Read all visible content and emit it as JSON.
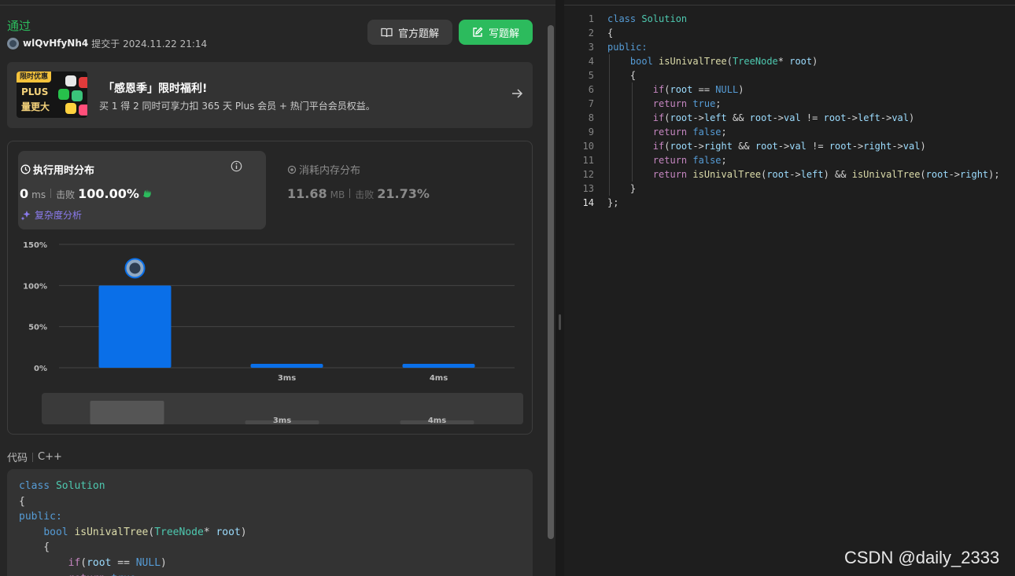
{
  "submission": {
    "status": "通过",
    "username": "wlQvHfyNh4",
    "submitted_text": "提交于 2024.11.22 21:14"
  },
  "buttons": {
    "official_solution": "官方题解",
    "write_solution": "写题解"
  },
  "promo": {
    "tag": "限时优惠",
    "image_line1": "PLUS",
    "image_line2": "量更大",
    "title": "「感恩季」限时福利!",
    "description": "买 1 得 2 同时可享力扣 365 天 Plus 会员 + 热门平台会员权益。"
  },
  "runtime": {
    "title": "执行用时分布",
    "value": "0",
    "unit": "ms",
    "beat_label": "击败",
    "beat_value": "100.00%",
    "complexity_link": "复杂度分析"
  },
  "memory": {
    "title": "消耗内存分布",
    "value": "11.68",
    "unit": "MB",
    "beat_label": "击败",
    "beat_value": "21.73%"
  },
  "chart_data": {
    "type": "bar",
    "categories": [
      "",
      "3ms",
      "4ms"
    ],
    "values": [
      100,
      3,
      3
    ],
    "yticks": [
      "150%",
      "100%",
      "50%",
      "0%"
    ],
    "ylim": [
      0,
      150
    ],
    "bar_color": "#0a6fe8",
    "grid": true,
    "mini_labels": [
      "3ms",
      "4ms"
    ]
  },
  "code_section": {
    "label": "代码",
    "language": "C++"
  },
  "code_preview_lines": [
    "class Solution",
    "{",
    "public:",
    "    bool isUnivalTree(TreeNode* root)",
    "    {",
    "        if(root == NULL)",
    "        return true;"
  ],
  "editor": {
    "active_line": 14,
    "lines": [
      "class Solution",
      "{",
      "public:",
      "    bool isUnivalTree(TreeNode* root)",
      "    {",
      "        if(root == NULL)",
      "        return true;",
      "        if(root->left && root->val != root->left->val)",
      "        return false;",
      "        if(root->right && root->val != root->right->val)",
      "        return false;",
      "        return isUnivalTree(root->left) && isUnivalTree(root->right);",
      "    }",
      "};"
    ]
  },
  "watermark": "CSDN @daily_2333",
  "colors": {
    "accent_green": "#2cbb5d",
    "bar_blue": "#0a6fe8",
    "link_purple": "#8c7cf0"
  }
}
